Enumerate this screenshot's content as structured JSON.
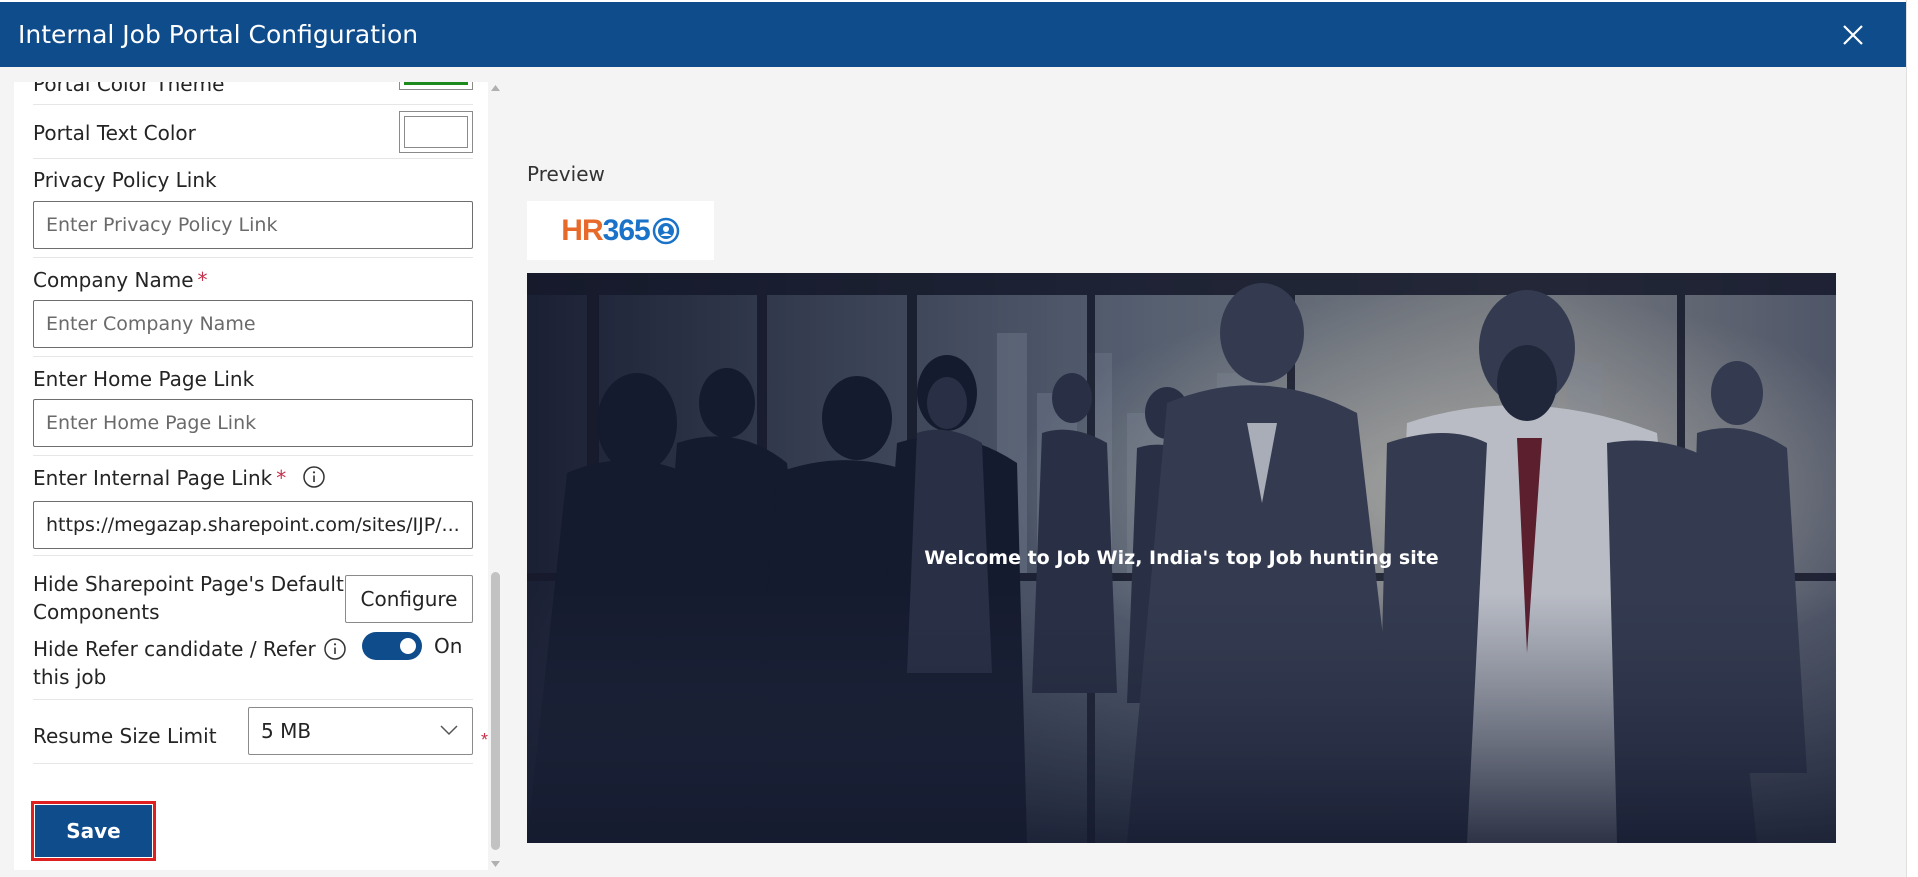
{
  "header": {
    "title": "Internal Job Portal Configuration"
  },
  "form": {
    "portal_color_theme": {
      "label": "Portal Color Theme",
      "color": "#1e8a1e"
    },
    "portal_text_color": {
      "label": "Portal Text Color",
      "color": "#ffffff"
    },
    "privacy_policy": {
      "label": "Privacy Policy Link",
      "placeholder": "Enter Privacy Policy Link",
      "value": ""
    },
    "company_name": {
      "label": "Company Name",
      "required_mark": "*",
      "placeholder": "Enter Company Name",
      "value": ""
    },
    "home_page": {
      "label": "Enter Home Page Link",
      "placeholder": "Enter Home Page Link",
      "value": ""
    },
    "internal_page": {
      "label": "Enter Internal Page Link",
      "required_mark": "*",
      "value": "https://megazap.sharepoint.com/sites/IJP/..."
    },
    "hide_default": {
      "label_line1": "Hide Sharepoint Page's Default",
      "label_line2": "Components",
      "button": "Configure"
    },
    "hide_refer": {
      "label_line1": "Hide Refer candidate / Refer",
      "label_line2": "this job",
      "toggle_on": true,
      "toggle_label": "On"
    },
    "resume_size": {
      "label": "Resume Size Limit",
      "value": "5 MB",
      "required_mark": "*"
    },
    "save_label": "Save"
  },
  "preview": {
    "label": "Preview",
    "logo": {
      "hr": "HR",
      "num": "365"
    },
    "banner_text": "Welcome to Job Wiz, India's top Job hunting site"
  },
  "colors": {
    "header": "#0f4c8c",
    "accent": "#0f4c8c",
    "save_outline": "#e02020"
  }
}
